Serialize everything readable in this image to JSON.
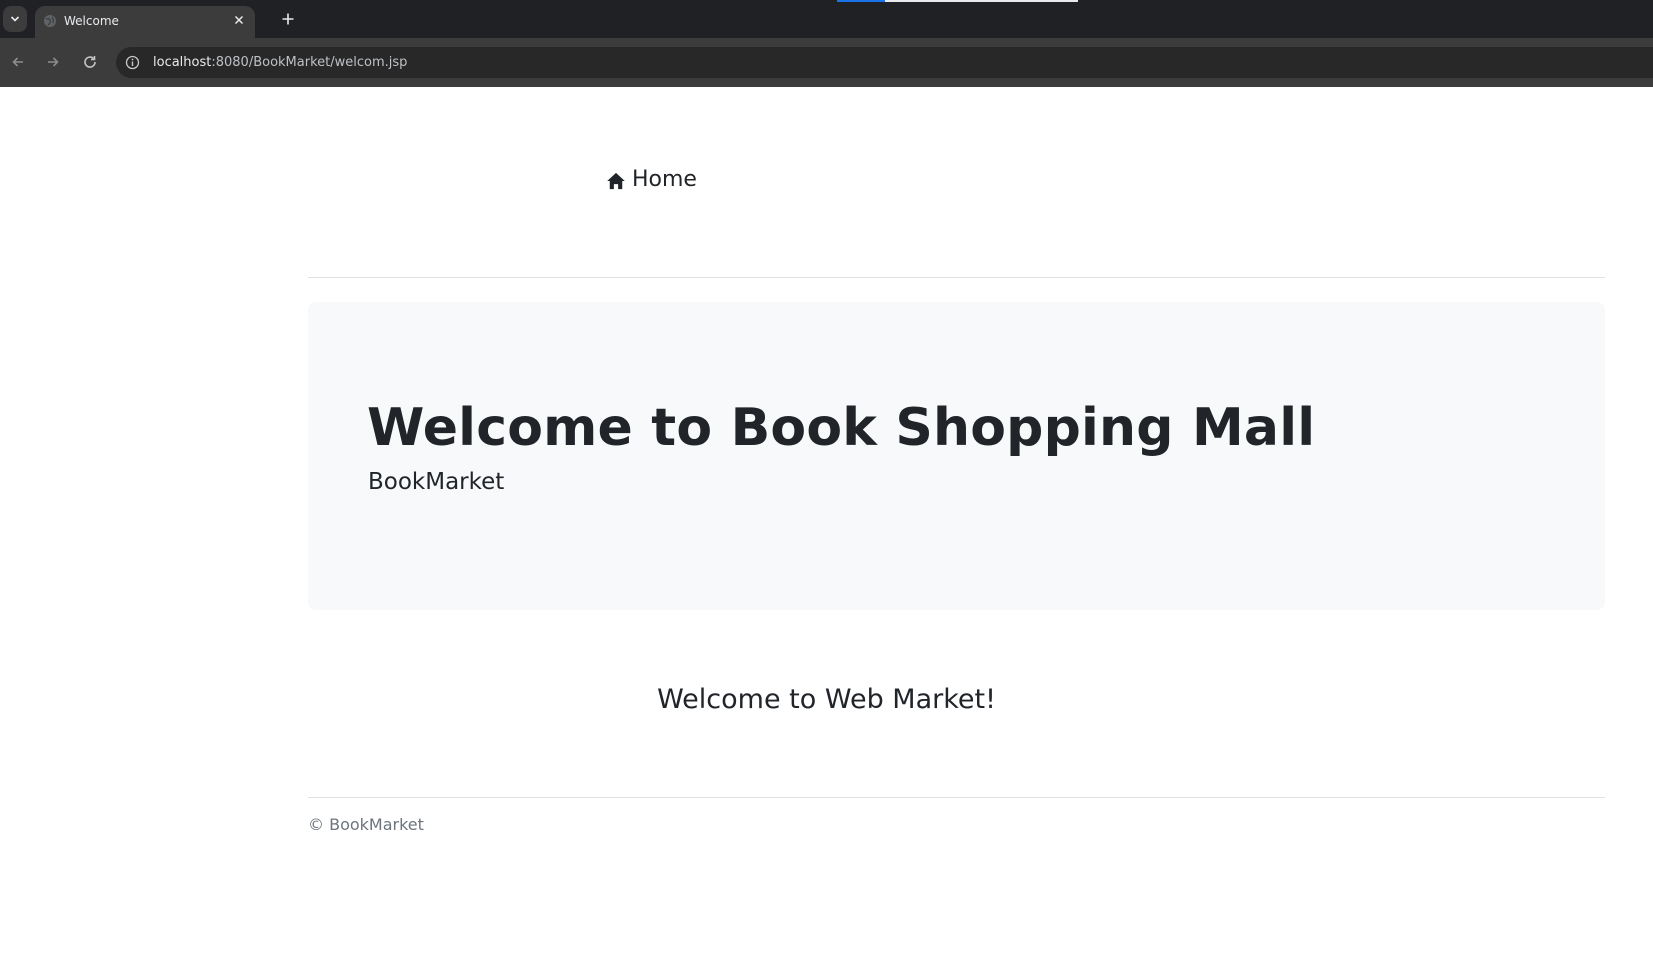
{
  "browser": {
    "tab_title": "Welcome",
    "url_host": "localhost",
    "url_rest": ":8080/BookMarket/welcom.jsp",
    "icons": {
      "tab_menu": "chevron-down-icon",
      "favicon": "globe-icon",
      "close": "close-icon",
      "new_tab": "plus-icon",
      "back": "arrow-left-icon",
      "forward": "arrow-right-icon",
      "reload": "reload-icon",
      "site_info": "info-icon"
    }
  },
  "nav": {
    "home_label": "Home",
    "home_icon": "home-icon"
  },
  "jumbotron": {
    "title": "Welcome to Book Shopping Mall",
    "subtitle": "BookMarket"
  },
  "main": {
    "greeting": "Welcome to Web Market!"
  },
  "footer": {
    "text": "© BookMarket"
  },
  "colors": {
    "chrome_dark": "#202124",
    "chrome_toolbar": "#3c3c3c",
    "jumbotron_bg": "#f8f9fa",
    "text": "#212529",
    "muted": "#6c757d"
  }
}
